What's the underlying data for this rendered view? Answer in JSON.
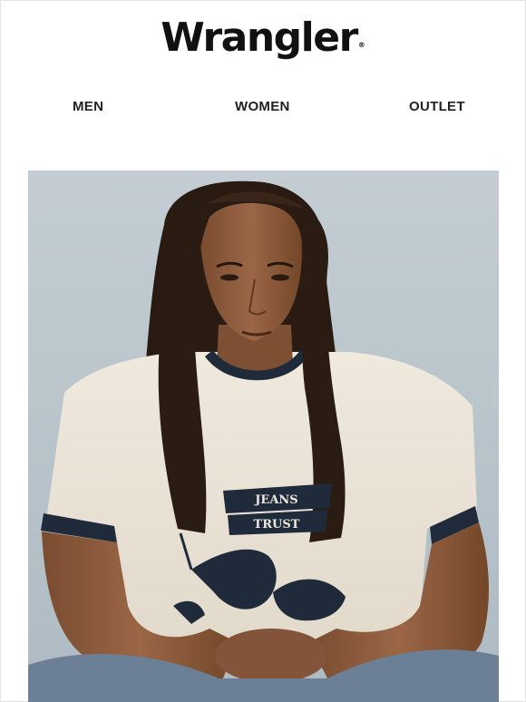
{
  "header": {
    "brand": "Wrangler",
    "registered_mark": "®"
  },
  "nav": {
    "items": [
      "MEN",
      "WOMEN",
      "OUTLET"
    ]
  },
  "hero": {
    "shirt_graphic_text": [
      "JEANS",
      "TRUST"
    ],
    "colors": {
      "sky": "#b9c4cb",
      "shirt": "#ece6da",
      "trim": "#1f2a3a",
      "hair": "#2a1b12",
      "skin": "#8a5a3c",
      "denim": "#6b7f96"
    }
  }
}
